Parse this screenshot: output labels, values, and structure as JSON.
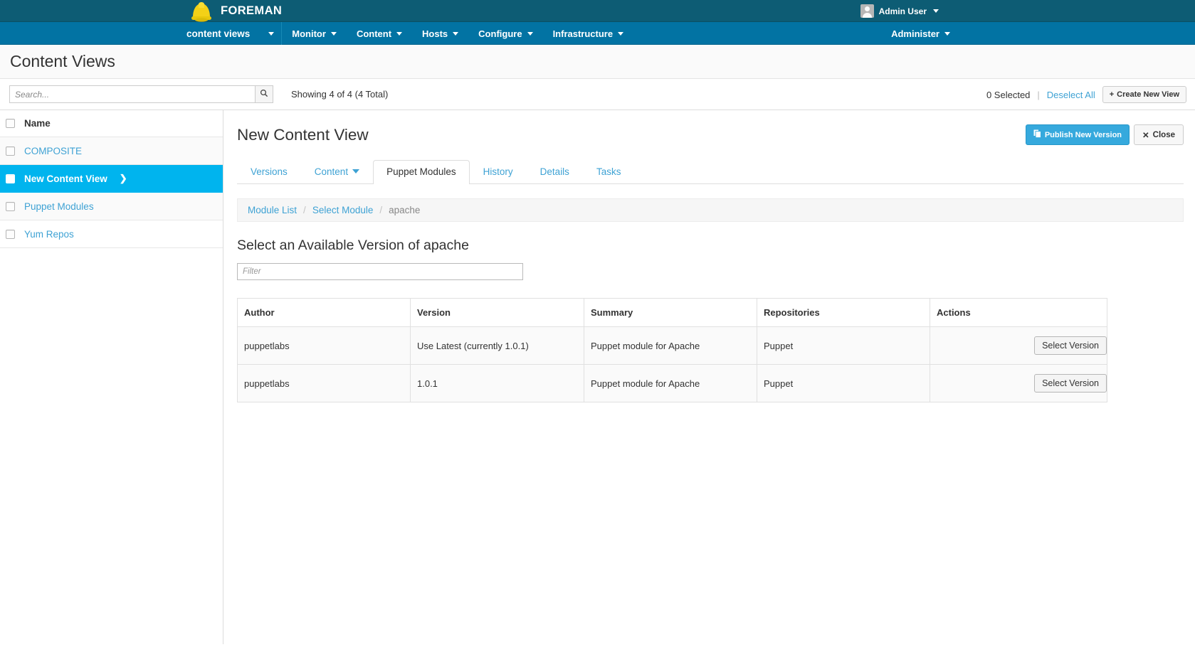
{
  "brand": {
    "name": "FOREMAN",
    "logo_icon": "hardhat-icon",
    "user": {
      "name": "Admin User",
      "avatar_icon": "user-avatar-icon",
      "caret_icon": "caret-down-icon"
    }
  },
  "nav": {
    "context": {
      "label": "content views",
      "caret_icon": "caret-down-icon"
    },
    "items": [
      {
        "label": "Monitor"
      },
      {
        "label": "Content"
      },
      {
        "label": "Hosts"
      },
      {
        "label": "Configure"
      },
      {
        "label": "Infrastructure"
      }
    ],
    "right": {
      "label": "Administer"
    }
  },
  "page": {
    "title": "Content Views"
  },
  "toolbar": {
    "search_placeholder": "Search...",
    "search_value": "",
    "search_icon": "search-icon",
    "showing": "Showing 4 of 4 (4 Total)",
    "selected_count": "0 Selected",
    "separator": "|",
    "deselect_all": "Deselect All",
    "create_button": "Create New View",
    "create_icon": "plus-icon"
  },
  "sidebar": {
    "header": "Name",
    "items": [
      {
        "label": "COMPOSITE",
        "active": false,
        "chevron": ""
      },
      {
        "label": "New Content View",
        "active": true,
        "chevron": "❯"
      },
      {
        "label": "Puppet Modules",
        "active": false,
        "chevron": ""
      },
      {
        "label": "Yum Repos",
        "active": false,
        "chevron": ""
      }
    ]
  },
  "detail": {
    "title": "New Content View",
    "publish_button": "Publish New Version",
    "publish_icon": "copy-icon",
    "close_button": "Close",
    "close_icon": "x-icon",
    "tabs": [
      {
        "label": "Versions",
        "active": false,
        "caret": false
      },
      {
        "label": "Content",
        "active": false,
        "caret": true
      },
      {
        "label": "Puppet Modules",
        "active": true,
        "caret": false
      },
      {
        "label": "History",
        "active": false,
        "caret": false
      },
      {
        "label": "Details",
        "active": false,
        "caret": false
      },
      {
        "label": "Tasks",
        "active": false,
        "caret": false
      }
    ],
    "breadcrumb": [
      {
        "label": "Module List",
        "current": false
      },
      {
        "label": "Select Module",
        "current": false
      },
      {
        "label": "apache",
        "current": true
      }
    ],
    "breadcrumb_separator": "/",
    "section_title": "Select an Available Version of apache",
    "filter_placeholder": "Filter",
    "filter_value": "",
    "table": {
      "columns": [
        "Author",
        "Version",
        "Summary",
        "Repositories",
        "Actions"
      ],
      "rows": [
        {
          "author": "puppetlabs",
          "version": "Use Latest (currently 1.0.1)",
          "summary": "Puppet module for Apache",
          "repositories": "Puppet",
          "action_label": "Select Version"
        },
        {
          "author": "puppetlabs",
          "version": "1.0.1",
          "summary": "Puppet module for Apache",
          "repositories": "Puppet",
          "action_label": "Select Version"
        }
      ]
    }
  },
  "colors": {
    "brandbar": "#0d5c74",
    "navbar": "#0273a3",
    "link": "#3ea2d4",
    "active_row": "#00b4ee",
    "primary_button": "#36a9dd",
    "hardhat": "#f3d117"
  }
}
